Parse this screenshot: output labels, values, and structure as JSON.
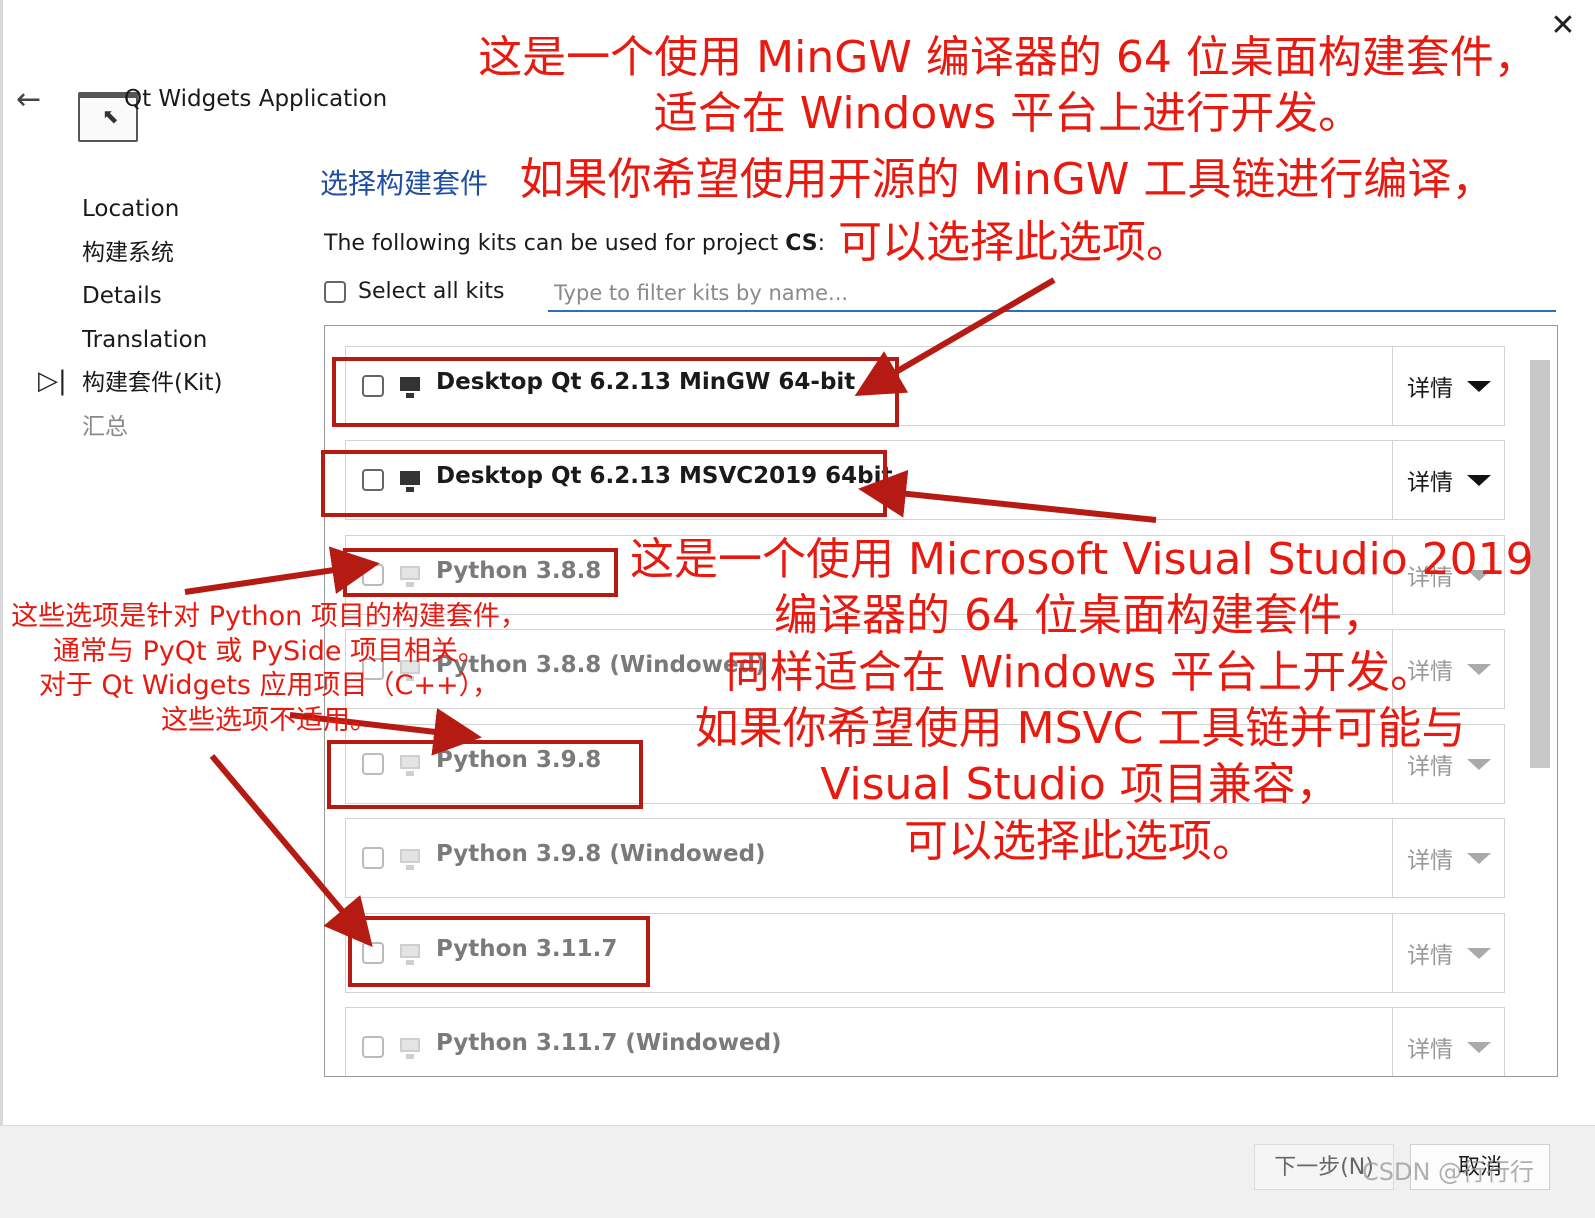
{
  "window": {
    "title": "Qt Widgets Application",
    "close_glyph": "✕",
    "back_glyph": "←"
  },
  "nav": {
    "items": [
      {
        "label": "Location",
        "state": "done"
      },
      {
        "label": "构建系统",
        "state": "done"
      },
      {
        "label": "Details",
        "state": "done"
      },
      {
        "label": "Translation",
        "state": "done"
      },
      {
        "label": "构建套件(Kit)",
        "state": "current"
      },
      {
        "label": "汇总",
        "state": "pending"
      }
    ],
    "current_marker": "▷|"
  },
  "page": {
    "heading": "选择构建套件",
    "project_prefix": "The following kits can be used for project ",
    "project_name": "CS",
    "project_suffix": ":",
    "select_all_label": "Select all kits",
    "filter_placeholder": "Type to filter kits by name..."
  },
  "kits": [
    {
      "name": "Desktop Qt 6.2.13 MinGW 64-bit",
      "enabled": true,
      "checked": false,
      "details_label": "详情"
    },
    {
      "name": "Desktop Qt 6.2.13 MSVC2019 64bit",
      "enabled": true,
      "checked": false,
      "details_label": "详情"
    },
    {
      "name": "Python 3.8.8",
      "enabled": false,
      "checked": false,
      "details_label": "详情"
    },
    {
      "name": "Python 3.8.8 (Windowed)",
      "enabled": false,
      "checked": false,
      "details_label": "详情"
    },
    {
      "name": "Python 3.9.8",
      "enabled": false,
      "checked": false,
      "details_label": "详情"
    },
    {
      "name": "Python 3.9.8 (Windowed)",
      "enabled": false,
      "checked": false,
      "details_label": "详情"
    },
    {
      "name": "Python 3.11.7",
      "enabled": false,
      "checked": false,
      "details_label": "详情"
    },
    {
      "name": "Python 3.11.7 (Windowed)",
      "enabled": false,
      "checked": false,
      "details_label": "详情"
    }
  ],
  "footer": {
    "next_label": "下一步(N)",
    "cancel_label": "取消",
    "watermark": "CSDN @行行行"
  },
  "annotations": {
    "mingw": [
      "这是一个使用 MinGW 编译器的 64 位桌面构建套件，",
      "适合在 Windows 平台上进行开发。",
      "如果你希望使用开源的 MinGW 工具链进行编译，",
      "可以选择此选项。"
    ],
    "msvc": [
      "这是一个使用 Microsoft Visual Studio 2019",
      "编译器的 64 位桌面构建套件，",
      "同样适合在 Windows 平台上开发。",
      "如果你希望使用 MSVC 工具链并可能与",
      "Visual Studio 项目兼容，",
      "可以选择此选项。"
    ],
    "python": [
      "这些选项是针对 Python 项目的构建套件，",
      "通常与 PyQt 或 PySide 项目相关。",
      "对于 Qt Widgets 应用项目（C++），",
      "这些选项不适用。"
    ],
    "color": "#e8190f",
    "box_color": "#b61b13"
  }
}
